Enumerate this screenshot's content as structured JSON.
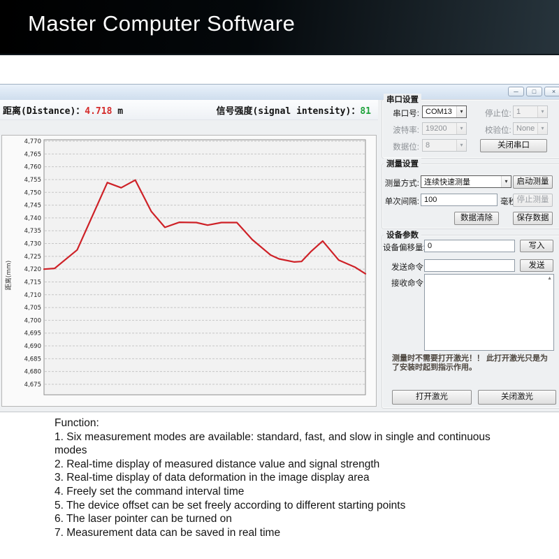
{
  "banner": {
    "title": "Master Computer Software"
  },
  "icons": {
    "minimize_glyph": "─",
    "maximize_glyph": "□",
    "close_glyph": "×",
    "dropdown_glyph": "▾",
    "scroll_up_glyph": "▲"
  },
  "status": {
    "distance_label": "距离(Distance)：",
    "distance_value": "4.718",
    "distance_unit": "m",
    "signal_label": "信号强度(signal intensity)：",
    "signal_value": "81"
  },
  "chart_data": {
    "type": "line",
    "title": "",
    "xlabel": "",
    "ylabel": "距离(mm)",
    "y_min": 4675,
    "y_max": 4770,
    "y_tick_step": 5,
    "y_tick_labels": [
      "4,770",
      "4,765",
      "4,760",
      "4,755",
      "4,750",
      "4,745",
      "4,740",
      "4,735",
      "4,730",
      "4,725",
      "4,720",
      "4,715",
      "4,710",
      "4,705",
      "4,700",
      "4,695",
      "4,690",
      "4,685",
      "4,680",
      "4,675"
    ],
    "grid": "horizontal-dashed",
    "legend": "none",
    "line_color": "#ce2127",
    "plot_bg": "#f2f2f2",
    "plot_border": "#8f8f8f",
    "grid_color": "#c6c6c6",
    "tick_color": "#222222",
    "points": [
      [
        0.0,
        4720.0
      ],
      [
        0.033,
        4720.3
      ],
      [
        0.103,
        4727.5
      ],
      [
        0.197,
        4753.8
      ],
      [
        0.24,
        4751.8
      ],
      [
        0.284,
        4754.8
      ],
      [
        0.334,
        4742.5
      ],
      [
        0.376,
        4736.3
      ],
      [
        0.421,
        4738.3
      ],
      [
        0.474,
        4738.2
      ],
      [
        0.509,
        4737.2
      ],
      [
        0.552,
        4738.2
      ],
      [
        0.6,
        4738.2
      ],
      [
        0.648,
        4731.5
      ],
      [
        0.705,
        4725.5
      ],
      [
        0.731,
        4724.0
      ],
      [
        0.779,
        4722.8
      ],
      [
        0.801,
        4723.0
      ],
      [
        0.83,
        4726.8
      ],
      [
        0.867,
        4731.0
      ],
      [
        0.917,
        4723.5
      ],
      [
        0.967,
        4720.8
      ],
      [
        1.0,
        4718.2
      ]
    ]
  },
  "serial": {
    "title": "串口设置",
    "port_label": "串口号:",
    "port_value": "COM13",
    "stop_label": "停止位:",
    "stop_value": "1",
    "baud_label": "波特率:",
    "baud_value": "19200",
    "parity_label": "校验位:",
    "parity_value": "None",
    "data_label": "数据位:",
    "data_value": "8",
    "close_button": "关闭串口"
  },
  "measure": {
    "title": "测量设置",
    "mode_label": "测量方式:",
    "mode_value": "连续快速测量",
    "start_button": "启动测量",
    "interval_label": "单次间隔:",
    "interval_value": "100",
    "interval_unit": "毫秒",
    "stop_button": "停止测量",
    "clear_button": "数据清除",
    "save_button": "保存数据"
  },
  "device": {
    "title": "设备参数",
    "offset_label": "设备偏移量:",
    "offset_value": "0",
    "write_button": "写入",
    "send_label": "发送命令:",
    "send_value": "",
    "send_button": "发送",
    "receive_label": "接收命令:",
    "receive_value": "",
    "note": "测量时不需要打开激光！！ 此打开激光只是为了安装时起到指示作用。",
    "laser_on_button": "打开激光",
    "laser_off_button": "关闭激光"
  },
  "functions": {
    "heading": "Function:",
    "items": [
      "1. Six measurement modes are available: standard, fast, and slow in single and continuous modes",
      "2. Real-time display of measured distance value and signal strength",
      "3. Real-time display of data deformation in the image display area",
      "4. Freely set the command interval time",
      "5. The device offset can be set freely according to different starting points",
      "6. The laser pointer can be turned on",
      "7. Measurement data can be saved in real time"
    ]
  }
}
